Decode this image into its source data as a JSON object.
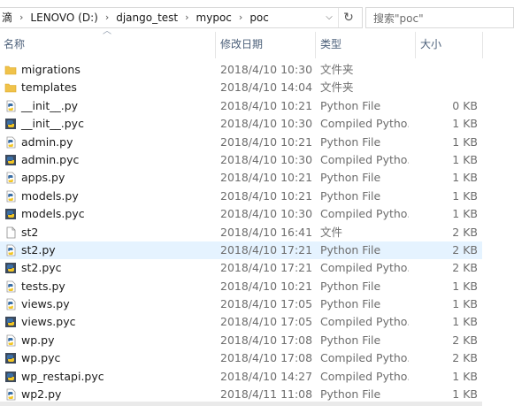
{
  "address": {
    "crumbs": [
      "滴",
      "LENOVO (D:)",
      "django_test",
      "mypoc",
      "poc"
    ],
    "separator": "›"
  },
  "search": {
    "placeholder": "搜索\"poc\""
  },
  "columns": {
    "name": "名称",
    "date": "修改日期",
    "type": "类型",
    "size": "大小"
  },
  "files": [
    {
      "name": "migrations",
      "date": "2018/4/10 10:30",
      "type": "文件夹",
      "size": "",
      "icon": "folder-icon"
    },
    {
      "name": "templates",
      "date": "2018/4/10 14:04",
      "type": "文件夹",
      "size": "",
      "icon": "folder-icon"
    },
    {
      "name": "__init__.py",
      "date": "2018/4/10 10:21",
      "type": "Python File",
      "size": "0 KB",
      "icon": "python-file-icon"
    },
    {
      "name": "__init__.pyc",
      "date": "2018/4/10 10:30",
      "type": "Compiled Pytho...",
      "size": "1 KB",
      "icon": "compiled-python-icon"
    },
    {
      "name": "admin.py",
      "date": "2018/4/10 10:21",
      "type": "Python File",
      "size": "1 KB",
      "icon": "python-file-icon"
    },
    {
      "name": "admin.pyc",
      "date": "2018/4/10 10:30",
      "type": "Compiled Pytho...",
      "size": "1 KB",
      "icon": "compiled-python-icon"
    },
    {
      "name": "apps.py",
      "date": "2018/4/10 10:21",
      "type": "Python File",
      "size": "1 KB",
      "icon": "python-file-icon"
    },
    {
      "name": "models.py",
      "date": "2018/4/10 10:21",
      "type": "Python File",
      "size": "1 KB",
      "icon": "python-file-icon"
    },
    {
      "name": "models.pyc",
      "date": "2018/4/10 10:30",
      "type": "Compiled Pytho...",
      "size": "1 KB",
      "icon": "compiled-python-icon"
    },
    {
      "name": "st2",
      "date": "2018/4/10 16:41",
      "type": "文件",
      "size": "2 KB",
      "icon": "blank-file-icon"
    },
    {
      "name": "st2.py",
      "date": "2018/4/10 17:21",
      "type": "Python File",
      "size": "2 KB",
      "icon": "python-file-icon",
      "selected": true
    },
    {
      "name": "st2.pyc",
      "date": "2018/4/10 17:21",
      "type": "Compiled Pytho...",
      "size": "2 KB",
      "icon": "compiled-python-icon"
    },
    {
      "name": "tests.py",
      "date": "2018/4/10 10:21",
      "type": "Python File",
      "size": "1 KB",
      "icon": "python-file-icon"
    },
    {
      "name": "views.py",
      "date": "2018/4/10 17:05",
      "type": "Python File",
      "size": "1 KB",
      "icon": "python-file-icon"
    },
    {
      "name": "views.pyc",
      "date": "2018/4/10 17:05",
      "type": "Compiled Pytho...",
      "size": "1 KB",
      "icon": "compiled-python-icon"
    },
    {
      "name": "wp.py",
      "date": "2018/4/10 17:08",
      "type": "Python File",
      "size": "2 KB",
      "icon": "python-file-icon"
    },
    {
      "name": "wp.pyc",
      "date": "2018/4/10 17:08",
      "type": "Compiled Pytho...",
      "size": "2 KB",
      "icon": "compiled-python-icon"
    },
    {
      "name": "wp_restapi.pyc",
      "date": "2018/4/10 14:27",
      "type": "Compiled Pytho...",
      "size": "1 KB",
      "icon": "compiled-python-icon"
    },
    {
      "name": "wp2.py",
      "date": "2018/4/11 11:08",
      "type": "Python File",
      "size": "1 KB",
      "icon": "python-file-icon"
    }
  ],
  "colors": {
    "selected_row": "#e5f3ff",
    "folder": "#f0c24a",
    "python_blue": "#3a6ea5",
    "python_yellow": "#f3c623",
    "header_text": "#4c607a"
  }
}
